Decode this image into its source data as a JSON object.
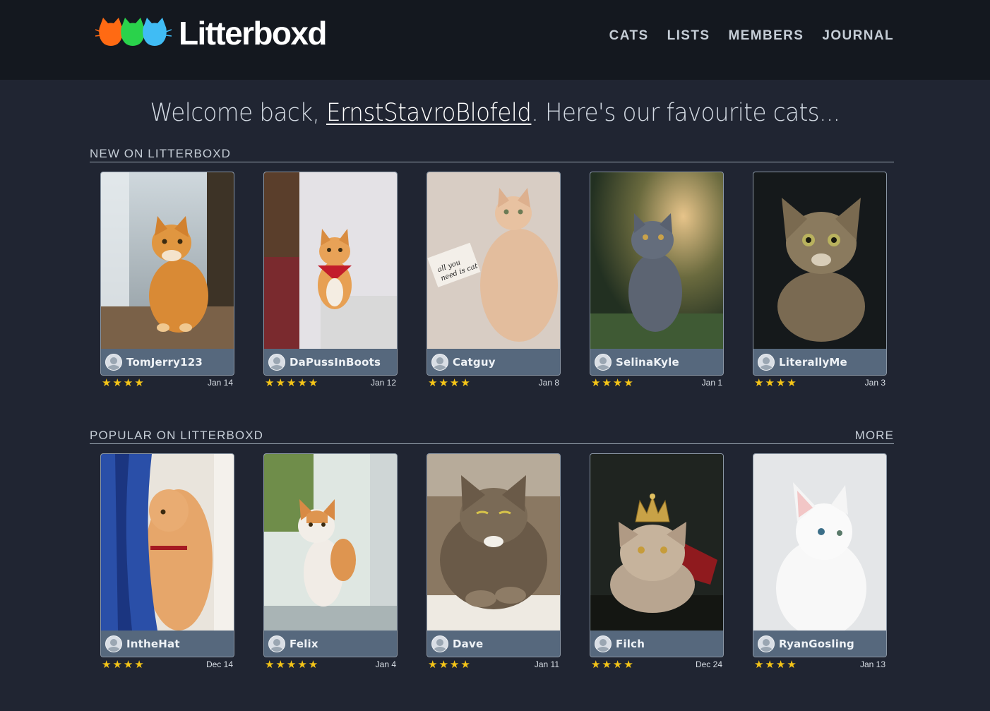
{
  "brand": {
    "name": "Litterboxd",
    "logo_icon": "three-cats-logo-icon"
  },
  "nav": [
    "CATS",
    "LISTS",
    "MEMBERS",
    "JOURNAL"
  ],
  "welcome": {
    "prefix": "Welcome back, ",
    "username": "ErnstStavroBlofeld",
    "suffix": ". Here's our favourite cats..."
  },
  "colors": {
    "page_bg": "#202532",
    "header_bg": "#14181f",
    "card_bar": "#56687d",
    "star": "#f5c518"
  },
  "new_section": {
    "title": "NEW ON LITTERBOXD",
    "cards": [
      {
        "user": "TomJerry123",
        "stars": 4,
        "star_text": "★★★★",
        "date": "Jan 14",
        "poster": "orange-tabby-window"
      },
      {
        "user": "DaPussInBoots",
        "stars": 5,
        "star_text": "★★★★★",
        "date": "Jan 12",
        "poster": "orange-cat-bandana"
      },
      {
        "user": "Catguy",
        "stars": 4,
        "star_text": "★★★★",
        "date": "Jan 8",
        "poster": "cream-cat-note"
      },
      {
        "user": "SelinaKyle",
        "stars": 4,
        "star_text": "★★★★",
        "date": "Jan 1",
        "poster": "grey-cat-grass"
      },
      {
        "user": "LiterallyMe",
        "stars": 4,
        "star_text": "★★★★",
        "date": "Jan 3",
        "poster": "tabby-cat-dark"
      }
    ]
  },
  "popular_section": {
    "title": "POPULAR ON LITTERBOXD",
    "more": "MORE",
    "cards": [
      {
        "user": "IntheHat",
        "stars": 4,
        "star_text": "★★★★",
        "date": "Dec 14",
        "poster": "orange-cat-curtain"
      },
      {
        "user": "Felix",
        "stars": 5,
        "star_text": "★★★★★",
        "date": "Jan 4",
        "poster": "orange-white-cat"
      },
      {
        "user": "Dave",
        "stars": 4,
        "star_text": "★★★★",
        "date": "Jan 11",
        "poster": "grumpy-tabby"
      },
      {
        "user": "Filch",
        "stars": 4,
        "star_text": "★★★★",
        "date": "Dec 24",
        "poster": "cat-with-crown"
      },
      {
        "user": "RyanGosling",
        "stars": 4,
        "star_text": "★★★★",
        "date": "Jan 13",
        "poster": "white-cat"
      }
    ]
  }
}
